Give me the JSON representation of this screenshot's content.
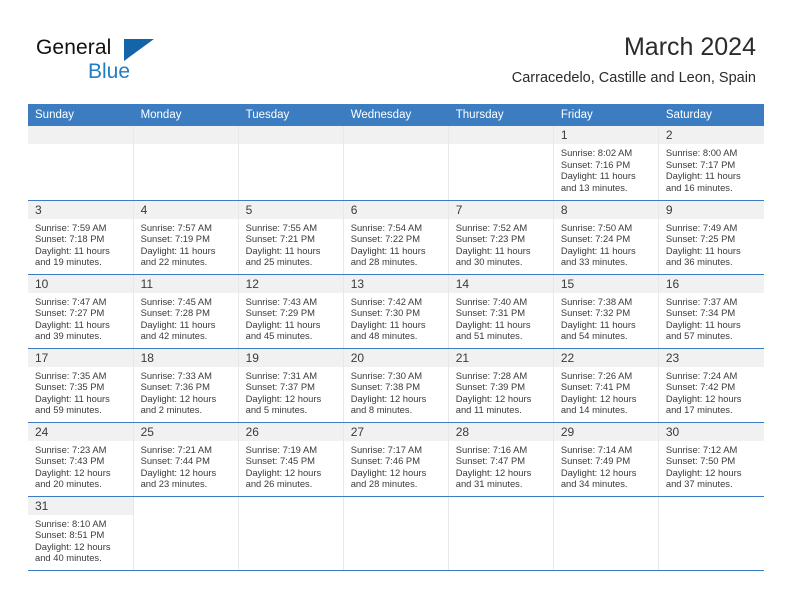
{
  "brand": {
    "name_top": "General",
    "name_bottom": "Blue",
    "triangle_color": "#1464aa",
    "blue_color": "#1f7ec4"
  },
  "header": {
    "title": "March 2024",
    "subtitle": "Carracedelo, Castille and Leon, Spain"
  },
  "theme": {
    "header_bg": "#3b7dc0",
    "daynum_bg": "#f1f1f1",
    "grid_line": "#3b7dc0",
    "text": "#3b3b3b"
  },
  "weekdays": [
    "Sunday",
    "Monday",
    "Tuesday",
    "Wednesday",
    "Thursday",
    "Friday",
    "Saturday"
  ],
  "labels": {
    "sunrise": "Sunrise:",
    "sunset": "Sunset:",
    "daylight": "Daylight:"
  },
  "weeks": [
    [
      {
        "day": "",
        "empty": true
      },
      {
        "day": "",
        "empty": true
      },
      {
        "day": "",
        "empty": true
      },
      {
        "day": "",
        "empty": true
      },
      {
        "day": "",
        "empty": true
      },
      {
        "day": "1",
        "sunrise": "Sunrise: 8:02 AM",
        "sunset": "Sunset: 7:16 PM",
        "daylight_1": "Daylight: 11 hours",
        "daylight_2": "and 13 minutes."
      },
      {
        "day": "2",
        "sunrise": "Sunrise: 8:00 AM",
        "sunset": "Sunset: 7:17 PM",
        "daylight_1": "Daylight: 11 hours",
        "daylight_2": "and 16 minutes."
      }
    ],
    [
      {
        "day": "3",
        "sunrise": "Sunrise: 7:59 AM",
        "sunset": "Sunset: 7:18 PM",
        "daylight_1": "Daylight: 11 hours",
        "daylight_2": "and 19 minutes."
      },
      {
        "day": "4",
        "sunrise": "Sunrise: 7:57 AM",
        "sunset": "Sunset: 7:19 PM",
        "daylight_1": "Daylight: 11 hours",
        "daylight_2": "and 22 minutes."
      },
      {
        "day": "5",
        "sunrise": "Sunrise: 7:55 AM",
        "sunset": "Sunset: 7:21 PM",
        "daylight_1": "Daylight: 11 hours",
        "daylight_2": "and 25 minutes."
      },
      {
        "day": "6",
        "sunrise": "Sunrise: 7:54 AM",
        "sunset": "Sunset: 7:22 PM",
        "daylight_1": "Daylight: 11 hours",
        "daylight_2": "and 28 minutes."
      },
      {
        "day": "7",
        "sunrise": "Sunrise: 7:52 AM",
        "sunset": "Sunset: 7:23 PM",
        "daylight_1": "Daylight: 11 hours",
        "daylight_2": "and 30 minutes."
      },
      {
        "day": "8",
        "sunrise": "Sunrise: 7:50 AM",
        "sunset": "Sunset: 7:24 PM",
        "daylight_1": "Daylight: 11 hours",
        "daylight_2": "and 33 minutes."
      },
      {
        "day": "9",
        "sunrise": "Sunrise: 7:49 AM",
        "sunset": "Sunset: 7:25 PM",
        "daylight_1": "Daylight: 11 hours",
        "daylight_2": "and 36 minutes."
      }
    ],
    [
      {
        "day": "10",
        "sunrise": "Sunrise: 7:47 AM",
        "sunset": "Sunset: 7:27 PM",
        "daylight_1": "Daylight: 11 hours",
        "daylight_2": "and 39 minutes."
      },
      {
        "day": "11",
        "sunrise": "Sunrise: 7:45 AM",
        "sunset": "Sunset: 7:28 PM",
        "daylight_1": "Daylight: 11 hours",
        "daylight_2": "and 42 minutes."
      },
      {
        "day": "12",
        "sunrise": "Sunrise: 7:43 AM",
        "sunset": "Sunset: 7:29 PM",
        "daylight_1": "Daylight: 11 hours",
        "daylight_2": "and 45 minutes."
      },
      {
        "day": "13",
        "sunrise": "Sunrise: 7:42 AM",
        "sunset": "Sunset: 7:30 PM",
        "daylight_1": "Daylight: 11 hours",
        "daylight_2": "and 48 minutes."
      },
      {
        "day": "14",
        "sunrise": "Sunrise: 7:40 AM",
        "sunset": "Sunset: 7:31 PM",
        "daylight_1": "Daylight: 11 hours",
        "daylight_2": "and 51 minutes."
      },
      {
        "day": "15",
        "sunrise": "Sunrise: 7:38 AM",
        "sunset": "Sunset: 7:32 PM",
        "daylight_1": "Daylight: 11 hours",
        "daylight_2": "and 54 minutes."
      },
      {
        "day": "16",
        "sunrise": "Sunrise: 7:37 AM",
        "sunset": "Sunset: 7:34 PM",
        "daylight_1": "Daylight: 11 hours",
        "daylight_2": "and 57 minutes."
      }
    ],
    [
      {
        "day": "17",
        "sunrise": "Sunrise: 7:35 AM",
        "sunset": "Sunset: 7:35 PM",
        "daylight_1": "Daylight: 11 hours",
        "daylight_2": "and 59 minutes."
      },
      {
        "day": "18",
        "sunrise": "Sunrise: 7:33 AM",
        "sunset": "Sunset: 7:36 PM",
        "daylight_1": "Daylight: 12 hours",
        "daylight_2": "and 2 minutes."
      },
      {
        "day": "19",
        "sunrise": "Sunrise: 7:31 AM",
        "sunset": "Sunset: 7:37 PM",
        "daylight_1": "Daylight: 12 hours",
        "daylight_2": "and 5 minutes."
      },
      {
        "day": "20",
        "sunrise": "Sunrise: 7:30 AM",
        "sunset": "Sunset: 7:38 PM",
        "daylight_1": "Daylight: 12 hours",
        "daylight_2": "and 8 minutes."
      },
      {
        "day": "21",
        "sunrise": "Sunrise: 7:28 AM",
        "sunset": "Sunset: 7:39 PM",
        "daylight_1": "Daylight: 12 hours",
        "daylight_2": "and 11 minutes."
      },
      {
        "day": "22",
        "sunrise": "Sunrise: 7:26 AM",
        "sunset": "Sunset: 7:41 PM",
        "daylight_1": "Daylight: 12 hours",
        "daylight_2": "and 14 minutes."
      },
      {
        "day": "23",
        "sunrise": "Sunrise: 7:24 AM",
        "sunset": "Sunset: 7:42 PM",
        "daylight_1": "Daylight: 12 hours",
        "daylight_2": "and 17 minutes."
      }
    ],
    [
      {
        "day": "24",
        "sunrise": "Sunrise: 7:23 AM",
        "sunset": "Sunset: 7:43 PM",
        "daylight_1": "Daylight: 12 hours",
        "daylight_2": "and 20 minutes."
      },
      {
        "day": "25",
        "sunrise": "Sunrise: 7:21 AM",
        "sunset": "Sunset: 7:44 PM",
        "daylight_1": "Daylight: 12 hours",
        "daylight_2": "and 23 minutes."
      },
      {
        "day": "26",
        "sunrise": "Sunrise: 7:19 AM",
        "sunset": "Sunset: 7:45 PM",
        "daylight_1": "Daylight: 12 hours",
        "daylight_2": "and 26 minutes."
      },
      {
        "day": "27",
        "sunrise": "Sunrise: 7:17 AM",
        "sunset": "Sunset: 7:46 PM",
        "daylight_1": "Daylight: 12 hours",
        "daylight_2": "and 28 minutes."
      },
      {
        "day": "28",
        "sunrise": "Sunrise: 7:16 AM",
        "sunset": "Sunset: 7:47 PM",
        "daylight_1": "Daylight: 12 hours",
        "daylight_2": "and 31 minutes."
      },
      {
        "day": "29",
        "sunrise": "Sunrise: 7:14 AM",
        "sunset": "Sunset: 7:49 PM",
        "daylight_1": "Daylight: 12 hours",
        "daylight_2": "and 34 minutes."
      },
      {
        "day": "30",
        "sunrise": "Sunrise: 7:12 AM",
        "sunset": "Sunset: 7:50 PM",
        "daylight_1": "Daylight: 12 hours",
        "daylight_2": "and 37 minutes."
      }
    ],
    [
      {
        "day": "31",
        "sunrise": "Sunrise: 8:10 AM",
        "sunset": "Sunset: 8:51 PM",
        "daylight_1": "Daylight: 12 hours",
        "daylight_2": "and 40 minutes."
      },
      {
        "day": "",
        "empty": true,
        "blank": true
      },
      {
        "day": "",
        "empty": true,
        "blank": true
      },
      {
        "day": "",
        "empty": true,
        "blank": true
      },
      {
        "day": "",
        "empty": true,
        "blank": true
      },
      {
        "day": "",
        "empty": true,
        "blank": true
      },
      {
        "day": "",
        "empty": true,
        "blank": true
      }
    ]
  ]
}
